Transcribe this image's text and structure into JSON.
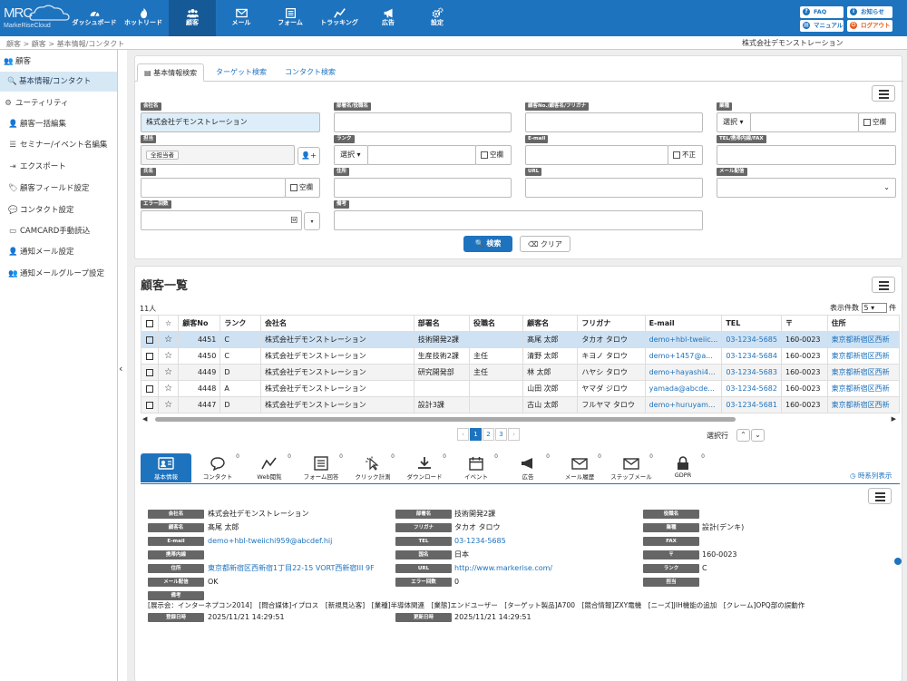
{
  "logo": {
    "line1": "MRC",
    "line2": "MarkeRiseCloud"
  },
  "nav": [
    {
      "label": "ダッシュボード",
      "icon": "dashboard-icon"
    },
    {
      "label": "ホットリード",
      "icon": "flame-icon"
    },
    {
      "label": "顧客",
      "icon": "users-icon",
      "active": true
    },
    {
      "label": "メール",
      "icon": "mail-icon"
    },
    {
      "label": "フォーム",
      "icon": "form-icon"
    },
    {
      "label": "トラッキング",
      "icon": "tracking-icon"
    },
    {
      "label": "広告",
      "icon": "megaphone-icon"
    },
    {
      "label": "設定",
      "icon": "gear-icon"
    }
  ],
  "topright": {
    "faq": "FAQ",
    "news": "お知らせ",
    "manual": "マニュアル",
    "logout": "ログアウト"
  },
  "breadcrumb": "顧客  >  顧客  >  基本情報/コンタクト",
  "company": "株式会社デモンストレーション",
  "sidebar": {
    "section1": "顧客",
    "active_item": "基本情報/コンタクト",
    "section2": "ユーティリティ",
    "items": [
      "顧客一括編集",
      "セミナー/イベント名編集",
      "エクスポート",
      "顧客フィールド設定",
      "コンタクト設定",
      "CAMCARD手動読込",
      "通知メール設定",
      "通知メールグループ設定"
    ]
  },
  "search": {
    "tabs": [
      "基本情報検索",
      "ターゲット検索",
      "コンタクト検索"
    ],
    "labels": {
      "company": "会社名",
      "dept": "部署名/役職名",
      "custno": "顧客No./顧客名/フリガナ",
      "industry": "業種",
      "owner": "担当",
      "rank": "ランク",
      "email": "E-mail",
      "telfax": "TEL/携帯内線/FAX",
      "name": "氏名",
      "address": "住所",
      "url": "URL",
      "mail_delivery": "メール配信",
      "errors": "エラー回数",
      "note": "備考"
    },
    "company_value": "株式会社デモンストレーション",
    "owner_value": "全担当者",
    "select_label": "選択",
    "blank_label": "空欄",
    "invalid_label": "不正",
    "error_unit": "回",
    "search_button": "検索",
    "clear_button": "クリア"
  },
  "list": {
    "title": "顧客一覧",
    "count": "11人",
    "per_page_label": "表示件数",
    "per_page_value": "5",
    "per_page_unit": "件",
    "columns": [
      "",
      "☆",
      "顧客No",
      "ランク",
      "会社名",
      "部署名",
      "役職名",
      "顧客名",
      "フリガナ",
      "E-mail",
      "TEL",
      "〒",
      "住所"
    ],
    "rows": [
      {
        "no": "4451",
        "rank": "C",
        "company": "株式会社デモンストレーション",
        "dept": "技術開発2課",
        "title": "",
        "name": "髙尾 太郎",
        "kana": "タカオ タロウ",
        "email": "demo+hbl-tweiic...",
        "tel": "03-1234-5685",
        "zip": "160-0023",
        "addr": "東京都新宿区西新"
      },
      {
        "no": "4450",
        "rank": "C",
        "company": "株式会社デモンストレーション",
        "dept": "生産技術2課",
        "title": "主任",
        "name": "清野 太郎",
        "kana": "キヨノ タロウ",
        "email": "demo+1457@a...",
        "tel": "03-1234-5684",
        "zip": "160-0023",
        "addr": "東京都新宿区西新"
      },
      {
        "no": "4449",
        "rank": "D",
        "company": "株式会社デモンストレーション",
        "dept": "研究開発部",
        "title": "主任",
        "name": "林 太郎",
        "kana": "ハヤシ タロウ",
        "email": "demo+hayashi4...",
        "tel": "03-1234-5683",
        "zip": "160-0023",
        "addr": "東京都新宿区西新"
      },
      {
        "no": "4448",
        "rank": "A",
        "company": "株式会社デモンストレーション",
        "dept": "",
        "title": "",
        "name": "山田 次郎",
        "kana": "ヤマダ ジロウ",
        "email": "yamada@abcde...",
        "tel": "03-1234-5682",
        "zip": "160-0023",
        "addr": "東京都新宿区西新"
      },
      {
        "no": "4447",
        "rank": "D",
        "company": "株式会社デモンストレーション",
        "dept": "設計3課",
        "title": "",
        "name": "古山 太郎",
        "kana": "フルヤマ タロウ",
        "email": "demo+huruyam...",
        "tel": "03-1234-5681",
        "zip": "160-0023",
        "addr": "東京都新宿区西新"
      }
    ],
    "pages": [
      "‹",
      "1",
      "2",
      "3",
      "›"
    ],
    "select_row": "選択行"
  },
  "detail_tabs": [
    {
      "label": "基本情報",
      "count": ""
    },
    {
      "label": "コンタクト",
      "count": "0"
    },
    {
      "label": "Web閲覧",
      "count": "0"
    },
    {
      "label": "フォーム回答",
      "count": "0"
    },
    {
      "label": "クリック計測",
      "count": "0"
    },
    {
      "label": "ダウンロード",
      "count": "0"
    },
    {
      "label": "イベント",
      "count": "0"
    },
    {
      "label": "広告",
      "count": "0"
    },
    {
      "label": "メール履歴",
      "count": "0"
    },
    {
      "label": "ステップメール",
      "count": "0"
    },
    {
      "label": "GDPR",
      "count": "0"
    }
  ],
  "timeline": "時系列表示",
  "detail": {
    "company_l": "会社名",
    "company_v": "株式会社デモンストレーション",
    "dept_l": "部署名",
    "dept_v": "技術開発2課",
    "title_l": "役職名",
    "title_v": "",
    "name_l": "顧客名",
    "name_v": "髙尾 太郎",
    "kana_l": "フリガナ",
    "kana_v": "タカオ タロウ",
    "industry_l": "業種",
    "industry_v": "設計(デンキ)",
    "email_l": "E-mail",
    "email_v": "demo+hbl-tweiichi959@abcdef.hij",
    "tel_l": "TEL",
    "tel_v": "03-1234-5685",
    "fax_l": "FAX",
    "fax_v": "",
    "mobile_l": "携帯内線",
    "mobile_v": "",
    "country_l": "国名",
    "country_v": "日本",
    "zip_l": "〒",
    "zip_v": "160-0023",
    "addr_l": "住所",
    "addr_v": "東京都新宿区西新宿1丁目22-15 VORT西新宿III 9F",
    "url_l": "URL",
    "url_v": "http://www.markerise.com/",
    "rank_l": "ランク",
    "rank_v": "C",
    "mail_l": "メール配信",
    "mail_v": "OK",
    "err_l": "エラー回数",
    "err_v": "0",
    "owner_l": "担当",
    "note_l": "備考",
    "note_v": "[展示会：インターネプコン2014]　[問合媒体]イプロス　[新規見込客]　[業種]半導体関連　[業態]エンドユーザー　[ターゲット製品]A700　[競合情報]ZXY電機　[ニーズ]JIH機能の追加　[クレーム]OPQ部の誤動作",
    "reg_l": "登録日時",
    "reg_v": "2025/11/21 14:29:51",
    "upd_l": "更新日時",
    "upd_v": "2025/11/21 14:29:51"
  }
}
